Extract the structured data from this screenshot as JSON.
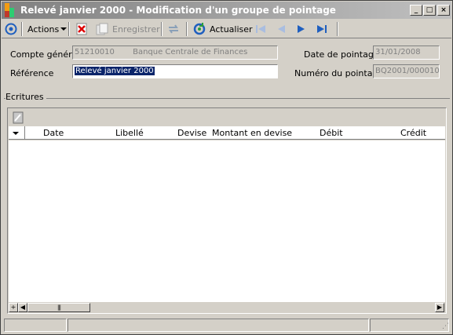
{
  "window": {
    "title": "Relevé janvier 2000 - Modification d'un groupe de pointage"
  },
  "toolbar": {
    "actions_label": "Actions",
    "save_label": "Enregistrer",
    "refresh_label": "Actualiser"
  },
  "form": {
    "account_label": "Compte général",
    "account_code": "51210010",
    "account_name": "Banque Centrale de Finances",
    "date_label": "Date de pointage",
    "date_value": "31/01/2008",
    "reference_label": "Référence",
    "reference_value": "Relevé janvier 2000",
    "number_label": "Numéro du pointage",
    "number_value": "BQ2001/000010"
  },
  "entries": {
    "group_title": "Ecritures",
    "columns": [
      "Date",
      "Libellé",
      "Devise",
      "Montant en devise",
      "Débit",
      "Crédit"
    ],
    "rows": []
  },
  "colors": {
    "window_bg": "#d4d0c8",
    "selection": "#0a246a",
    "icon_blue": "#1f5fbf"
  }
}
